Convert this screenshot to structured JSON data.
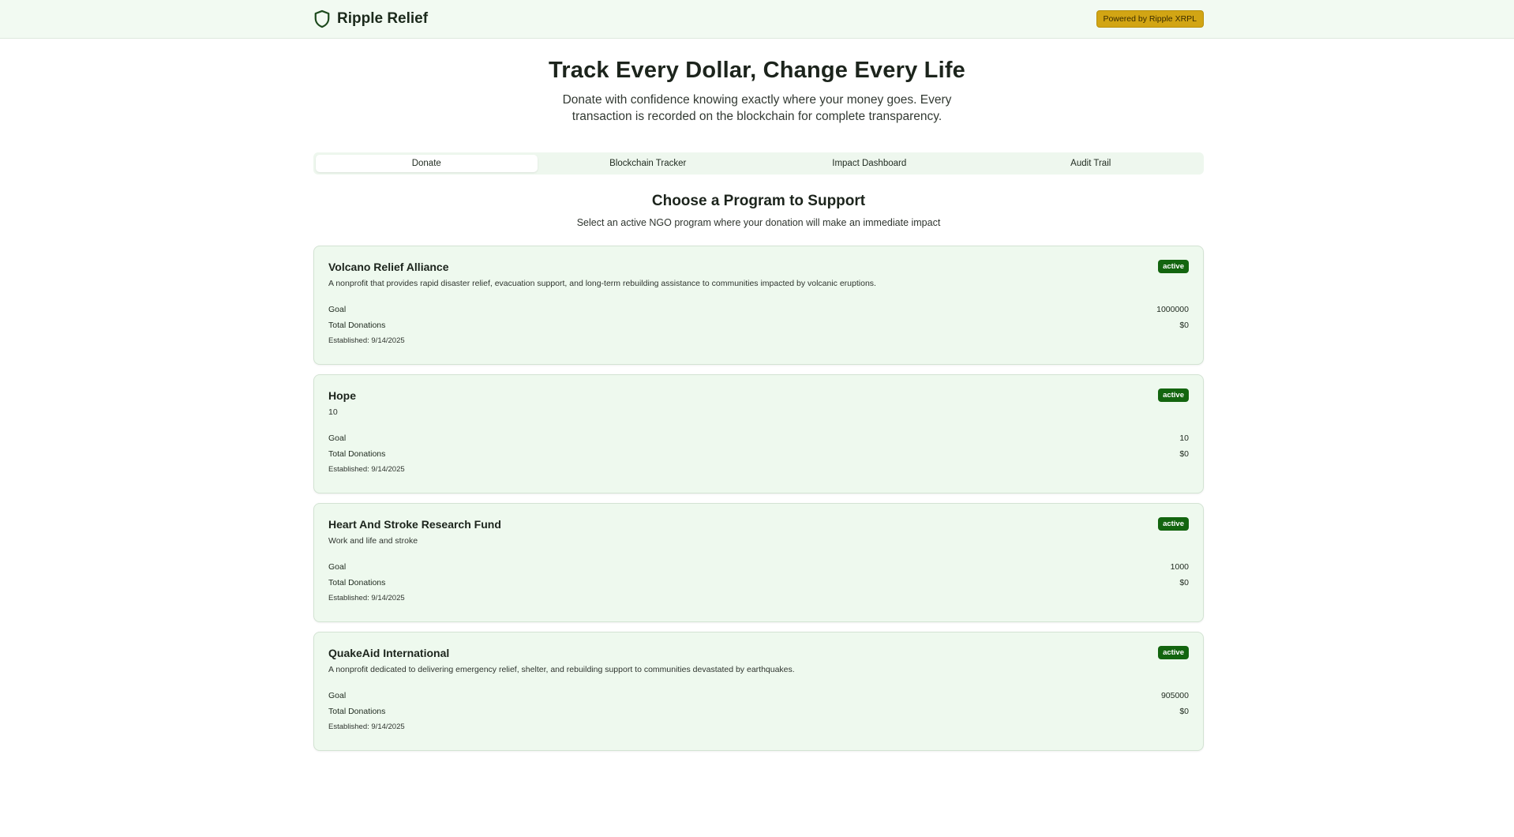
{
  "header": {
    "brand_name": "Ripple Relief",
    "brand_icon": "shield-icon",
    "powered_badge": "Powered by Ripple XRPL"
  },
  "hero": {
    "title": "Track Every Dollar, Change Every Life",
    "subtitle": "Donate with confidence knowing exactly where your money goes. Every transaction is recorded on the blockchain for complete transparency."
  },
  "tabs": [
    {
      "label": "Donate",
      "active": true
    },
    {
      "label": "Blockchain Tracker",
      "active": false
    },
    {
      "label": "Impact Dashboard",
      "active": false
    },
    {
      "label": "Audit Trail",
      "active": false
    }
  ],
  "section": {
    "title": "Choose a Program to Support",
    "subtitle": "Select an active NGO program where your donation will make an immediate impact"
  },
  "labels": {
    "goal": "Goal",
    "total_donations": "Total Donations"
  },
  "programs": [
    {
      "name": "Volcano Relief Alliance",
      "status": "active",
      "description": "A nonprofit that provides rapid disaster relief, evacuation support, and long-term rebuilding assistance to communities impacted by volcanic eruptions.",
      "goal": "1000000",
      "total_donations": "$0",
      "established": "Established: 9/14/2025"
    },
    {
      "name": "Hope",
      "status": "active",
      "description": "10",
      "goal": "10",
      "total_donations": "$0",
      "established": "Established: 9/14/2025"
    },
    {
      "name": "Heart And Stroke Research Fund",
      "status": "active",
      "description": "Work and life and stroke",
      "goal": "1000",
      "total_donations": "$0",
      "established": "Established: 9/14/2025"
    },
    {
      "name": "QuakeAid International",
      "status": "active",
      "description": "A nonprofit dedicated to delivering emergency relief, shelter, and rebuilding support to communities devastated by earthquakes.",
      "goal": "905000",
      "total_donations": "$0",
      "established": "Established: 9/14/2025"
    }
  ],
  "colors": {
    "accent_green": "#13650f",
    "card_bg": "#eef9ee",
    "badge_gold": "#d2a514"
  }
}
